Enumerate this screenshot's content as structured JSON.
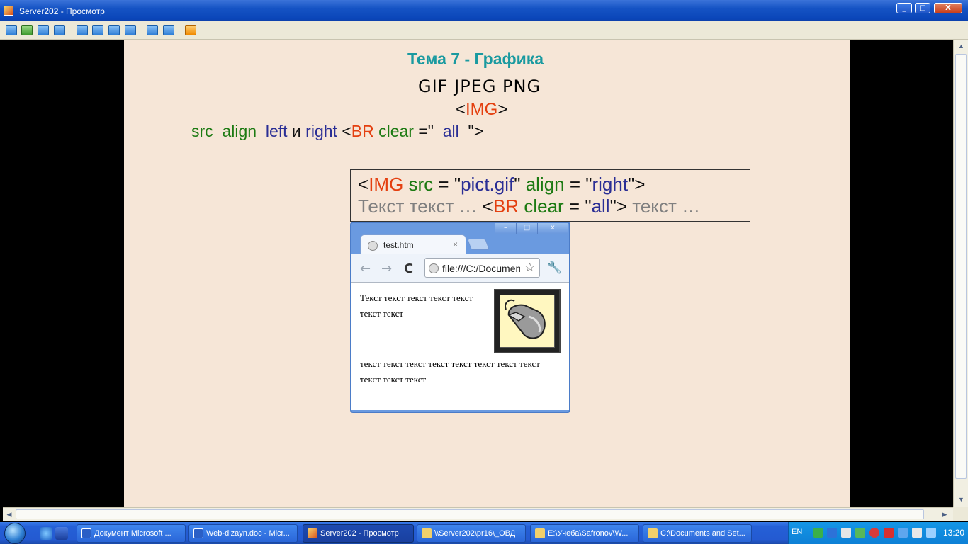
{
  "window": {
    "title": "Server202 - Просмотр",
    "min": "_",
    "max": "□",
    "close": "X"
  },
  "slide": {
    "heading": "Тема 7 - Графика",
    "formats": "GIF JPEG PNG",
    "img_open": "<",
    "img_name": "IMG",
    "img_close": ">",
    "attrs": {
      "src": "src",
      "align": "align",
      "left": "left",
      "and": "и",
      "right": "right",
      "lt": "<",
      "br": "BR",
      "clear": "clear",
      "eq": "=\"",
      "all": "all",
      "end": "\">"
    },
    "code": {
      "line1": {
        "lt": "<",
        "img": "IMG",
        "src": "src",
        "eq1": " = \"",
        "pict": "pict.gif",
        "q1": "\" ",
        "align": "align",
        "eq2": " = \"",
        "right": "right",
        "end": "\">"
      },
      "line2": {
        "text1": "Текст текст … ",
        "lt": "<",
        "br": "BR",
        "clear": "clear",
        "eq": " = \"",
        "all": "all",
        "end": "\">",
        "text2": " текст …"
      }
    }
  },
  "browser": {
    "tab_title": "test.htm",
    "tab_close": "×",
    "url": "file:///C:/Documents",
    "win_min": "–",
    "win_max": "□",
    "win_close": "x",
    "back": "←",
    "forward": "→",
    "reload": "C",
    "star": "☆",
    "wrench": "🔧",
    "para1": "Текст текст текст текст текст текст текст",
    "para2": "текст текст текст текст текст текст текст текст текст текст текст"
  },
  "taskbar": {
    "tasks": [
      {
        "label": "Документ Microsoft ..."
      },
      {
        "label": "Web-dizayn.doc - Micr..."
      },
      {
        "label": "Server202 - Просмотр"
      },
      {
        "label": "\\\\Server202\\pr16\\_ОВД"
      },
      {
        "label": "E:\\Учеба\\Safronov\\W..."
      },
      {
        "label": "C:\\Documents and Set..."
      }
    ],
    "lang": "EN",
    "clock": "13:20"
  },
  "colors": {
    "slide_bg": "#f6e6d7",
    "heading": "#1a9aa0",
    "attr_green": "#1c7a12",
    "attr_blue": "#2a2e95",
    "tag_red": "#e43f0f"
  }
}
